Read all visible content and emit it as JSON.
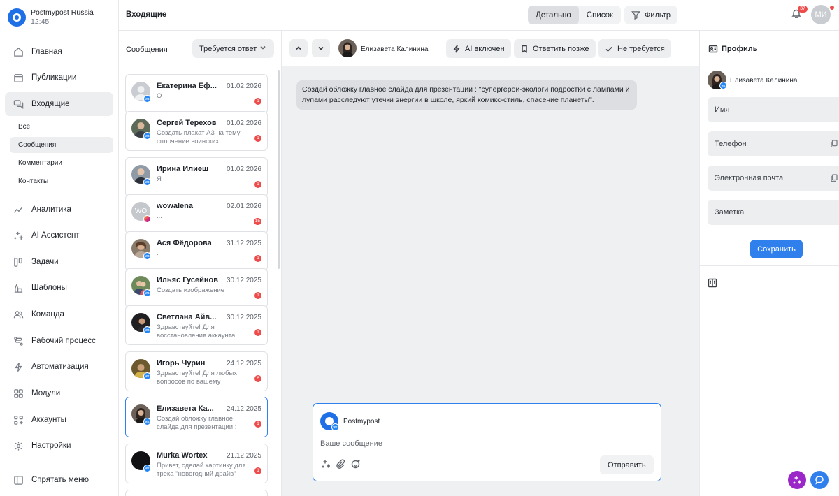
{
  "brand": {
    "name": "Postmypost Russia",
    "time": "12:45"
  },
  "nav": {
    "home": "Главная",
    "publications": "Публикации",
    "inbox": "Входящие",
    "inbox_sub": {
      "all": "Все",
      "messages": "Сообщения",
      "comments": "Комментарии",
      "contacts": "Контакты"
    },
    "analytics": "Аналитика",
    "ai_assistant": "AI Ассистент",
    "tasks": "Задачи",
    "templates": "Шаблоны",
    "team": "Команда",
    "workflow": "Рабочий процесс",
    "automation": "Автоматизация",
    "modules": "Модули",
    "accounts": "Аккаунты",
    "settings": "Настройки",
    "hide_menu": "Спрятать меню"
  },
  "topbar": {
    "title": "Входящие",
    "view_detailed": "Детально",
    "view_list": "Список",
    "filter": "Фильтр",
    "notifications_count": "37",
    "user_initials": "МИ"
  },
  "list": {
    "title": "Сообщения",
    "status_filter": "Требуется ответ",
    "conversations": [
      {
        "name": "Екатерина Еф...",
        "date": "01.02.2026",
        "preview": "О",
        "unread": "1",
        "initials": ""
      },
      {
        "name": "Сергей Терехов",
        "date": "01.02.2026",
        "preview": "Создать плакат А3 на тему сплочение воинских коллектив...",
        "unread": "1",
        "initials": ""
      },
      {
        "name": "Ирина Илиеш",
        "date": "01.02.2026",
        "preview": "Я",
        "unread": "1",
        "initials": ""
      },
      {
        "name": "wowalena",
        "date": "02.01.2026",
        "preview": "...",
        "unread": "15",
        "initials": "WO"
      },
      {
        "name": "Ася Фёдорова",
        "date": "31.12.2025",
        "preview": ".",
        "unread": "1",
        "initials": ""
      },
      {
        "name": "Ильяс Гусейнов",
        "date": "30.12.2025",
        "preview": "Создать изображение",
        "unread": "1",
        "initials": ""
      },
      {
        "name": "Светлана Айв...",
        "date": "30.12.2025",
        "preview": "Здравствуйте! Для восстановления аккаунта,...",
        "unread": "1",
        "initials": ""
      },
      {
        "name": "Игорь Чурин",
        "date": "24.12.2025",
        "preview": "Здравствуйте! Для любых вопросов по вашему аккаунту,...",
        "unread": "6",
        "initials": ""
      },
      {
        "name": "Елизавета Ка...",
        "date": "24.12.2025",
        "preview": "Создай обложку главное слайда для презентации : \"супергерои...",
        "unread": "1",
        "initials": ""
      },
      {
        "name": "Murka Wortex",
        "date": "21.12.2025",
        "preview": "Привет, сделай картинку для трека \"новогодний драйв\"",
        "unread": "1",
        "initials": ""
      }
    ]
  },
  "chat": {
    "contact_name": "Елизавета Калинина",
    "ai_enabled": "AI включен",
    "reply_later": "Ответить позже",
    "no_reply_needed": "Не требуется",
    "message_text": "Создай обложку главное слайда для презентации : \"супергерои-экологи подростки с лампами и лупами расследуют утечки энергии в школе, яркий комикс-стиль, спасение планеты\".",
    "composer": {
      "sender": "Postmypost",
      "placeholder": "Ваше сообщение",
      "send": "Отправить"
    }
  },
  "profile": {
    "title": "Профиль",
    "name": "Елизавета Калинина",
    "fields": {
      "name": "Имя",
      "phone": "Телефон",
      "email": "Электронная почта",
      "note": "Заметка"
    },
    "save": "Сохранить"
  },
  "colors": {
    "accent": "#2f80ed",
    "badge": "#ee4b4b",
    "vk": "#2787f5",
    "ai_fab": "#9b27c8"
  },
  "icons": {
    "vk_badge": "VK",
    "ig_badge": "instagram-icon"
  }
}
